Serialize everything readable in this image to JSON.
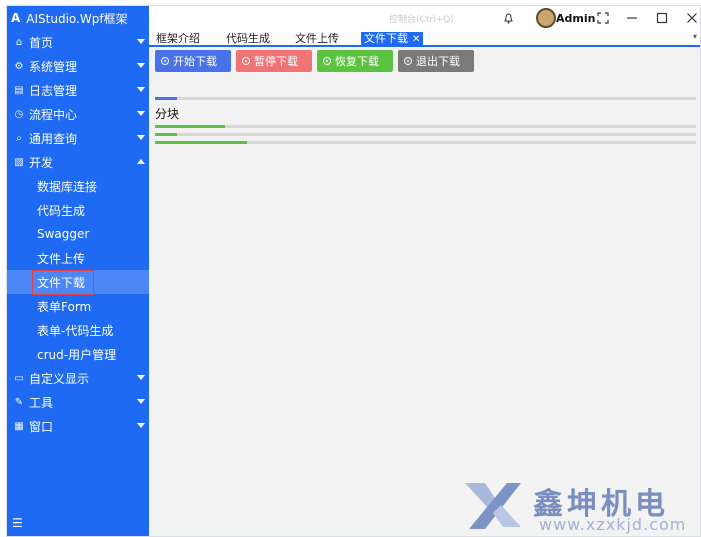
{
  "app": {
    "logo_glyph": "A",
    "title": "AIStudio.Wpf框架"
  },
  "titlebar": {
    "center_title": "控制台(Ctrl+Q)",
    "user": "Admin"
  },
  "sidebar": {
    "items": [
      {
        "label": "首页",
        "icon": "home-icon",
        "glyph": "⌂"
      },
      {
        "label": "系统管理",
        "icon": "gear-icon",
        "glyph": "⚙"
      },
      {
        "label": "日志管理",
        "icon": "log-icon",
        "glyph": "▤"
      },
      {
        "label": "流程中心",
        "icon": "clock-icon",
        "glyph": "◷"
      },
      {
        "label": "通用查询",
        "icon": "search-icon",
        "glyph": "⌕"
      },
      {
        "label": "开发",
        "icon": "code-icon",
        "glyph": "▧"
      }
    ],
    "subitems": [
      "数据库连接",
      "代码生成",
      "Swagger",
      "文件上传",
      "文件下载",
      "表单Form",
      "表单-代码生成",
      "crud-用户管理"
    ],
    "bottom_items": [
      {
        "label": "自定义显示",
        "icon": "monitor-icon",
        "glyph": "▭"
      },
      {
        "label": "工具",
        "icon": "wrench-icon",
        "glyph": "✎"
      },
      {
        "label": "窗口",
        "icon": "window-icon",
        "glyph": "▦"
      }
    ],
    "footer_glyph": "☰"
  },
  "tabs": [
    "框架介绍",
    "代码生成",
    "文件上传",
    "文件下载"
  ],
  "tab_close": "✕",
  "toolbar": {
    "start": "开始下载",
    "pause": "暂停下载",
    "resume": "恢复下载",
    "exit": "退出下载"
  },
  "colors": {
    "accent": "#1e6af2",
    "start": "#4a72e8",
    "pause": "#f07474",
    "resume": "#5cc341",
    "exit": "#7a7a7a",
    "progress_green": "#5cc341"
  },
  "progress": {
    "main": 0.04,
    "section_label": "分块",
    "chunks": [
      0.13,
      0.04,
      0.17
    ]
  },
  "watermark": {
    "name": "鑫坤机电",
    "url": "www.xzxkjd.com"
  }
}
